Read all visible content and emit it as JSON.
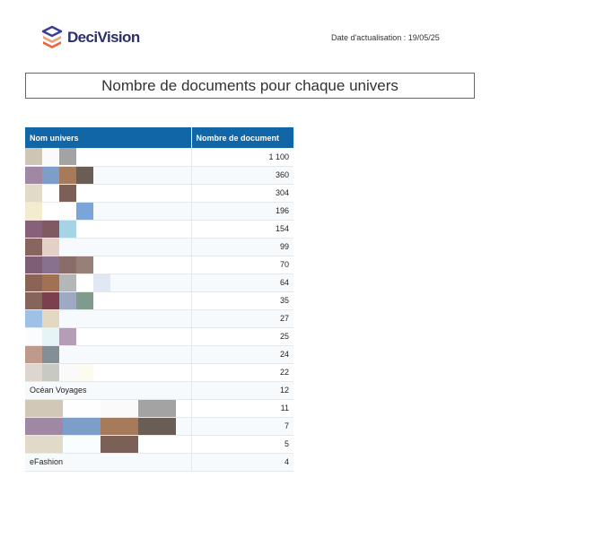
{
  "header": {
    "brand": "DeciVision",
    "update_label": "Date d'actualisation : 19/05/25"
  },
  "report": {
    "title": "Nombre de documents pour chaque univers"
  },
  "table": {
    "columns": [
      "Nom univers",
      "Nombre de document"
    ],
    "rows": [
      {
        "name": "",
        "count": "1 100",
        "pixels": [
          "#cfc5b4",
          "#fafafa",
          "#a3a3a3"
        ]
      },
      {
        "name": "",
        "count": "360",
        "pixels": [
          "#a087a4",
          "#7c9ec8",
          "#a67b5c",
          "#6a5d56"
        ]
      },
      {
        "name": "",
        "count": "304",
        "pixels": [
          "#e2dac9",
          "#fefefe",
          "#7b6057"
        ]
      },
      {
        "name": "",
        "count": "196",
        "pixels": [
          "#f4ecd1",
          "#ffffff",
          "#fdfdfd",
          "#7ba5d8"
        ]
      },
      {
        "name": "",
        "count": "154",
        "pixels": [
          "#87607a",
          "#7f5a63",
          "#a7d3e6"
        ]
      },
      {
        "name": "",
        "count": "99",
        "pixels": [
          "#86665e",
          "#e3d1c7"
        ]
      },
      {
        "name": "",
        "count": "70",
        "pixels": [
          "#7e5e76",
          "#86718f",
          "#8a6c68",
          "#968077"
        ]
      },
      {
        "name": "",
        "count": "64",
        "pixels": [
          "#8c6456",
          "#a17153",
          "#b4b6b8",
          "#ffffff",
          "#e0e9f3"
        ]
      },
      {
        "name": "",
        "count": "35",
        "pixels": [
          "#86635b",
          "#7c3f4e",
          "#9fa9c3",
          "#7f9b8b"
        ]
      },
      {
        "name": "",
        "count": "27",
        "pixels": [
          "#a0c1e6",
          "#e3d8c2"
        ]
      },
      {
        "name": "",
        "count": "25",
        "pixels": [
          "#fafcfd",
          "#e6f4f5",
          "#b59eb5"
        ]
      },
      {
        "name": "",
        "count": "24",
        "pixels": [
          "#bd9a8b",
          "#858d96"
        ]
      },
      {
        "name": "",
        "count": "22",
        "pixels": [
          "#ddd5cf",
          "#c9c9c3",
          "#fafafa",
          "#fbfbf2"
        ]
      },
      {
        "name": "Océan Voyages",
        "count": "12",
        "pixels": []
      },
      {
        "name": "",
        "count": "11",
        "pixels": [
          "#d1c8b8",
          "#fefefe",
          "#fafafa",
          "#a3a3a3"
        ],
        "big": true
      },
      {
        "name": "",
        "count": "7",
        "pixels": [
          "#a087a4",
          "#7c9ec8",
          "#a67b5c",
          "#6a5d56"
        ],
        "big": true
      },
      {
        "name": "",
        "count": "5",
        "pixels": [
          "#e2dac9",
          "#f8fdff",
          "#7b6057",
          "#ffffff"
        ],
        "big": true
      },
      {
        "name": "eFashion",
        "count": "4",
        "pixels": []
      }
    ]
  },
  "colors": {
    "header_bg": "#1166a8",
    "brand_text": "#2b2f6b",
    "logo_primary": "#3b3d94",
    "logo_accent": "#e8683c"
  }
}
